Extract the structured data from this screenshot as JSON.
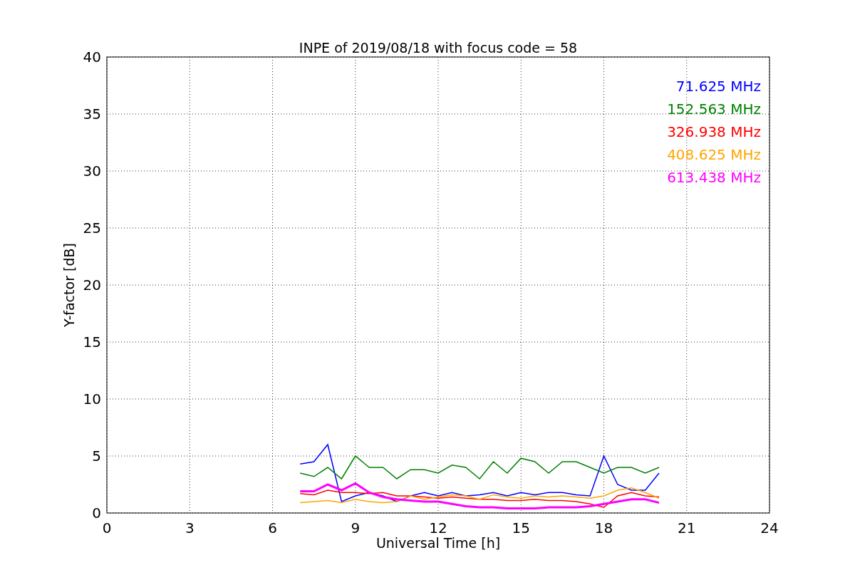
{
  "figure": {
    "chart_data": {
      "type": "line",
      "title": "INPE of 2019/08/18 with focus code = 58",
      "xlabel": "Universal Time [h]",
      "ylabel": "Y-factor [dB]",
      "x": [
        7,
        7.5,
        8,
        8.5,
        9,
        9.5,
        10,
        10.5,
        11,
        11.5,
        12,
        12.5,
        13,
        13.5,
        14,
        14.5,
        15,
        15.5,
        16,
        16.5,
        17,
        17.5,
        18,
        18.5,
        19,
        19.5,
        20
      ],
      "series": [
        {
          "name": "71.625 MHz",
          "color": "#0000ff",
          "values": [
            4.3,
            4.5,
            6.0,
            1.0,
            1.5,
            1.8,
            1.5,
            1.0,
            1.5,
            1.8,
            1.5,
            1.8,
            1.5,
            1.6,
            1.8,
            1.5,
            1.8,
            1.6,
            1.8,
            1.8,
            1.6,
            1.5,
            5.0,
            2.5,
            2.0,
            2.0,
            3.5
          ]
        },
        {
          "name": "152.563 MHz",
          "color": "#008000",
          "values": [
            3.5,
            3.2,
            4.0,
            3.0,
            5.0,
            4.0,
            4.0,
            3.0,
            3.8,
            3.8,
            3.5,
            4.2,
            4.0,
            3.0,
            4.5,
            3.5,
            4.8,
            4.5,
            3.5,
            4.5,
            4.5,
            4.0,
            3.5,
            4.0,
            4.0,
            3.5,
            4.0
          ]
        },
        {
          "name": "326.938 MHz",
          "color": "#ff0000",
          "values": [
            1.7,
            1.6,
            2.0,
            1.8,
            1.8,
            1.7,
            1.8,
            1.5,
            1.5,
            1.4,
            1.3,
            1.4,
            1.3,
            1.2,
            1.2,
            1.1,
            1.1,
            1.2,
            1.1,
            1.1,
            1.0,
            0.8,
            0.5,
            1.5,
            1.8,
            1.5,
            1.4
          ]
        },
        {
          "name": "408.625 MHz",
          "color": "#ffa500",
          "values": [
            0.9,
            1.0,
            1.1,
            0.9,
            1.2,
            1.0,
            0.9,
            1.0,
            1.5,
            1.2,
            1.4,
            1.6,
            1.5,
            1.2,
            1.6,
            1.4,
            1.3,
            1.5,
            1.4,
            1.5,
            1.4,
            1.3,
            1.5,
            2.0,
            2.2,
            1.8,
            1.3
          ]
        },
        {
          "name": "613.438 MHz",
          "color": "#ff00ff",
          "values": [
            1.9,
            1.9,
            2.5,
            2.0,
            2.6,
            1.8,
            1.4,
            1.2,
            1.1,
            1.0,
            1.0,
            0.8,
            0.6,
            0.5,
            0.5,
            0.4,
            0.4,
            0.4,
            0.5,
            0.5,
            0.5,
            0.6,
            0.8,
            1.0,
            1.2,
            1.2,
            0.9
          ]
        }
      ],
      "grid": true,
      "xlim": [
        0,
        24
      ],
      "ylim": [
        0,
        40
      ],
      "xticks": [
        0,
        3,
        6,
        9,
        12,
        15,
        18,
        21,
        24
      ],
      "yticks": [
        0,
        5,
        10,
        15,
        20,
        25,
        30,
        35,
        40
      ]
    }
  }
}
